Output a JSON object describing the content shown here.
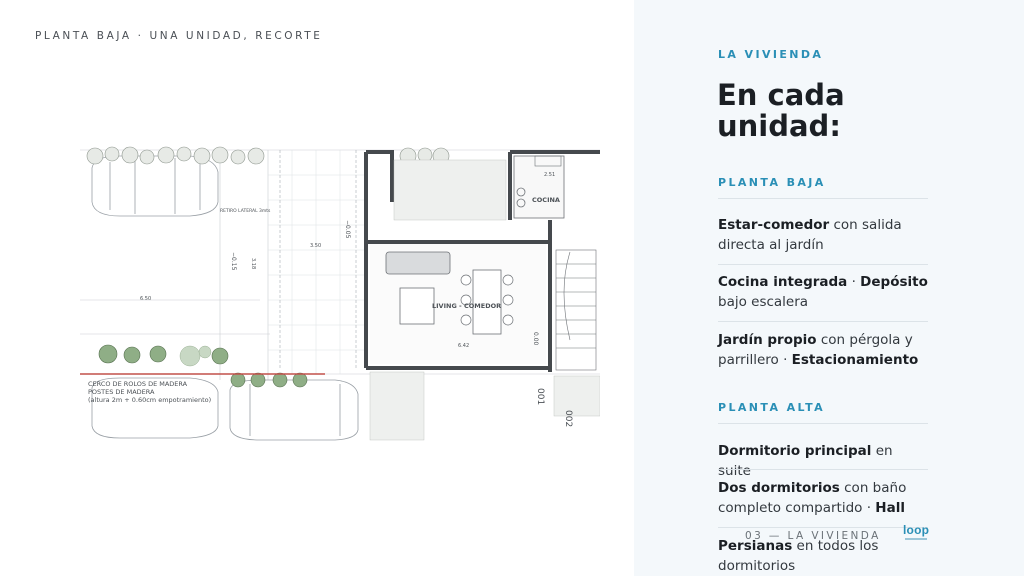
{
  "left": {
    "caption": "PLANTA BAJA · UNA UNIDAD, RECORTE",
    "plan": {
      "labels": {
        "cocina": "COCINA",
        "living": "LIVING - COMEDOR",
        "fence1": "CERCO DE ROLOS DE MADERA",
        "fence2": "POSTES DE MADERA",
        "fence3": "(altura 2m + 0.60cm empotramiento)",
        "retiro": "RETIRO LATERAL 3mts",
        "unit1": "001",
        "unit2": "002",
        "level1": "−0.15",
        "level2": "−0.05",
        "level3": "0.00",
        "dim1": "6.50",
        "dim2": "3.50",
        "dim3": "6.42",
        "dim4": "3.18",
        "dim5": "2.51"
      }
    }
  },
  "right": {
    "eyebrow": "LA VIVIENDA",
    "heading": "En cada unidad:",
    "planta_baja": {
      "title": "PLANTA BAJA",
      "items": [
        {
          "bold1": "Estar-comedor",
          "text1": " con salida directa al jardín"
        },
        {
          "bold1": "Cocina integrada",
          "text1": " · ",
          "bold2": "Depósito",
          "text2": " bajo escalera"
        },
        {
          "bold1": "Jardín propio",
          "text1": " con pérgola y parrillero · ",
          "bold2": "Estacionamiento"
        }
      ]
    },
    "planta_alta": {
      "title": "PLANTA ALTA",
      "items": [
        {
          "bold1": "Dormitorio principal",
          "text1": " en suite"
        },
        {
          "bold1": "Dos dormitorios",
          "text1": " con baño completo compartido · ",
          "bold2": "Hall"
        },
        {
          "bold1": "Persianas",
          "text1": " en todos los dormitorios"
        }
      ]
    },
    "footer": "03 — LA VIVIENDA",
    "logo": "loop"
  }
}
